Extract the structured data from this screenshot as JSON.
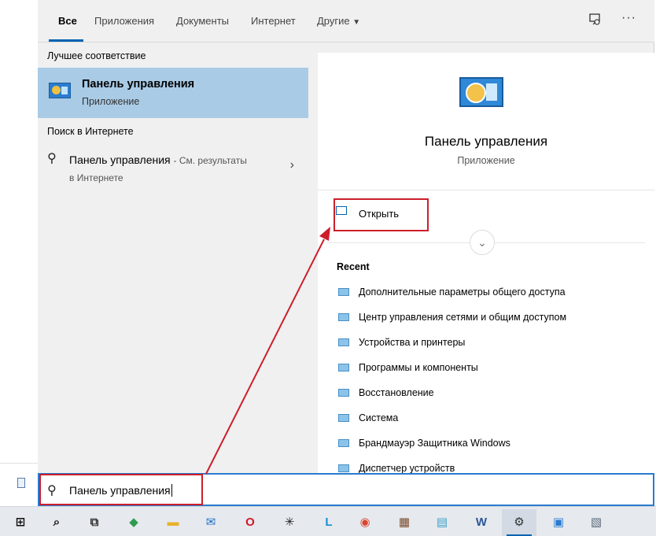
{
  "tabs": [
    {
      "label": "Все",
      "active": true
    },
    {
      "label": "Приложения",
      "active": false
    },
    {
      "label": "Документы",
      "active": false
    },
    {
      "label": "Интернет",
      "active": false
    },
    {
      "label": "Другие",
      "active": false,
      "has_dropdown": true
    }
  ],
  "tab_icons": {
    "feedback": "feedback-icon",
    "more": "more-icon",
    "more_glyph": "···"
  },
  "left": {
    "best_match_heading": "Лучшее соответствие",
    "best_match": {
      "title": "Панель управления",
      "subtitle": "Приложение",
      "icon": "control-panel-icon"
    },
    "web_heading": "Поиск в Интернете",
    "web_result": {
      "query": "Панель управления",
      "hint": "- См. результаты",
      "hint2": "в Интернете"
    }
  },
  "detail": {
    "title": "Панель управления",
    "subtitle": "Приложение",
    "open_label": "Открыть",
    "recent_heading": "Recent",
    "recent_items": [
      "Дополнительные параметры общего доступа",
      "Центр управления сетями и общим доступом",
      "Устройства и принтеры",
      "Программы и компоненты",
      "Восстановление",
      "Система",
      "Брандмауэр Защитника Windows",
      "Диспетчер устройств"
    ]
  },
  "search": {
    "value": "Панель управления"
  },
  "colors": {
    "accent": "#0063b1",
    "selected": "#a9cbe6",
    "annotation": "#cc1f2a"
  },
  "taskbar": [
    {
      "name": "windows-start-icon",
      "glyph": "⊞",
      "color": "#111"
    },
    {
      "name": "search-icon",
      "glyph": "⌕",
      "color": "#111"
    },
    {
      "name": "task-view-icon",
      "glyph": "⧉",
      "color": "#333"
    },
    {
      "name": "shield-app-icon",
      "glyph": "◆",
      "color": "#2e9b4e"
    },
    {
      "name": "file-explorer-icon",
      "glyph": "▬",
      "color": "#e8b22e"
    },
    {
      "name": "mail-icon",
      "glyph": "✉",
      "color": "#1e6fc8"
    },
    {
      "name": "opera-icon",
      "glyph": "O",
      "color": "#d4162b"
    },
    {
      "name": "cursor-app-icon",
      "glyph": "✳",
      "color": "#222"
    },
    {
      "name": "l-app-icon",
      "glyph": "L",
      "color": "#1a8fd6"
    },
    {
      "name": "chrome-icon",
      "glyph": "◉",
      "color": "#d9462f"
    },
    {
      "name": "archive-app-icon",
      "glyph": "▦",
      "color": "#7a4a2a"
    },
    {
      "name": "notepad-app-icon",
      "glyph": "▤",
      "color": "#3aa0c8"
    },
    {
      "name": "word-icon",
      "glyph": "W",
      "color": "#2b5797"
    },
    {
      "name": "settings-icon",
      "glyph": "⚙",
      "color": "#333"
    },
    {
      "name": "control-panel-taskbar-icon",
      "glyph": "▣",
      "color": "#2a7ccf"
    },
    {
      "name": "image-app-icon",
      "glyph": "▧",
      "color": "#5a6a7a"
    }
  ]
}
